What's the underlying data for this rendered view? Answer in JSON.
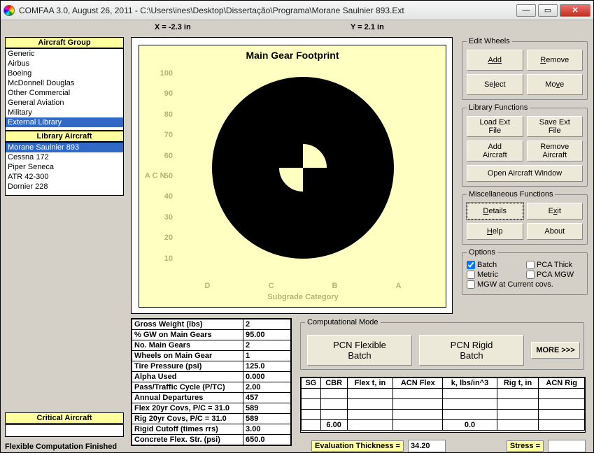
{
  "window": {
    "title": "COMFAA 3.0, August 26, 2011 - C:\\Users\\ines\\Desktop\\Dissertação\\Programa\\Morane Saulnier 893.Ext",
    "min_icon": "—",
    "max_icon": "▭",
    "close_icon": "✕"
  },
  "coords": {
    "x_label": "X = -2.3 in",
    "y_label": "Y = 2.1 in"
  },
  "left": {
    "aircraft_group_header": "Aircraft Group",
    "aircraft_group_items": [
      "Generic",
      "Airbus",
      "Boeing",
      "McDonnell Douglas",
      "Other Commercial",
      "General Aviation",
      "Military",
      "External Library"
    ],
    "aircraft_group_selected": 7,
    "library_header": "Library Aircraft",
    "library_items": [
      "Morane Saulnier 893",
      "Cessna 172",
      "Piper Seneca",
      "ATR 42-300",
      "Dornier 228"
    ],
    "library_selected": 0,
    "critical_header": "Critical Aircraft",
    "status": "Flexible Computation Finished"
  },
  "chart_data": {
    "type": "diagram",
    "title": "Main Gear Footprint",
    "xlabel": "Subgrade Category",
    "ylabel": "A\nC\nN",
    "y_ticks": [
      10,
      20,
      30,
      40,
      50,
      60,
      70,
      80,
      90,
      100
    ],
    "x_ticks": [
      "D",
      "C",
      "B",
      "A"
    ]
  },
  "props": [
    [
      "Gross Weight (lbs)",
      "2"
    ],
    [
      "% GW on Main Gears",
      "95.00"
    ],
    [
      "No. Main Gears",
      "2"
    ],
    [
      "Wheels on Main Gear",
      "1"
    ],
    [
      "Tire Pressure (psi)",
      "125.0"
    ],
    [
      "Alpha Used",
      "0.000"
    ],
    [
      "Pass/Traffic Cycle (P/TC)",
      "2.00"
    ],
    [
      "Annual Departures",
      "457"
    ],
    [
      "Flex 20yr Covs, P/C = 31.0",
      "589"
    ],
    [
      "Rig 20yr Covs, P/C = 31.0",
      "589"
    ],
    [
      "Rigid Cutoff (times rrs)",
      "3.00"
    ],
    [
      "Concrete Flex. Str. (psi)",
      "650.0"
    ]
  ],
  "right": {
    "edit_wheels_legend": "Edit Wheels",
    "add": "Add",
    "remove": "Remove",
    "select": "Select",
    "move": "Move",
    "lib_legend": "Library Functions",
    "load_ext": "Load Ext\nFile",
    "save_ext": "Save Ext\nFile",
    "add_aircraft": "Add\nAircraft",
    "remove_aircraft": "Remove\nAircraft",
    "open_window": "Open Aircraft Window",
    "misc_legend": "Miscellaneous Functions",
    "details": "Details",
    "exit": "Exit",
    "help": "Help",
    "about": "About",
    "options_legend": "Options",
    "opt_batch": "Batch",
    "opt_pca_thick": "PCA Thick",
    "opt_metric": "Metric",
    "opt_pca_mgw": "PCA MGW",
    "opt_mgw_current": "MGW at Current covs."
  },
  "comp": {
    "legend": "Computational Mode",
    "pcn_flex": "PCN Flexible\nBatch",
    "pcn_rigid": "PCN Rigid\nBatch",
    "more": "MORE >>>"
  },
  "results": {
    "headers": [
      "SG",
      "CBR",
      "Flex t, in",
      "ACN Flex",
      "k, lbs/in^3",
      "Rig t, in",
      "ACN Rig"
    ],
    "row": [
      "",
      "6.00",
      "",
      "",
      "0.0",
      "",
      ""
    ]
  },
  "bottom": {
    "eval_label": "Evaluation Thickness =",
    "eval_value": "34.20",
    "stress_label": "Stress =",
    "stress_value": ""
  }
}
